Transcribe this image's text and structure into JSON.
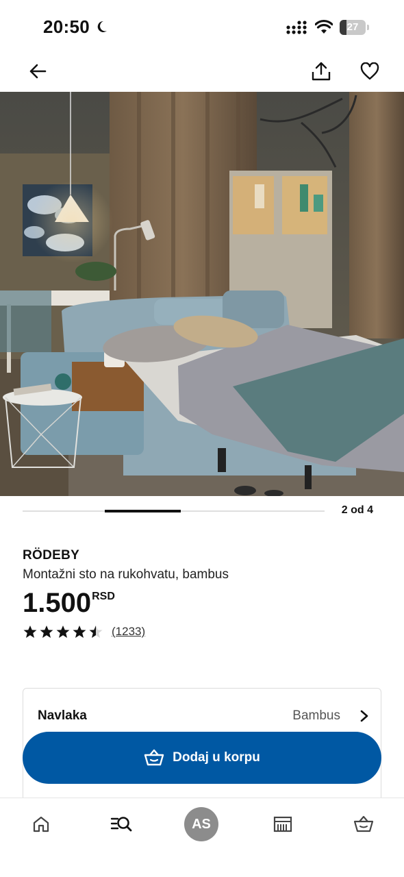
{
  "status_bar": {
    "time": "20:50",
    "battery_level": "27",
    "battery_fraction": 0.27
  },
  "nav": {
    "back_icon": "arrow-left-icon",
    "share_icon": "share-icon",
    "favorite_icon": "heart-icon"
  },
  "gallery": {
    "position_label": "2 od 4",
    "current_index": 2,
    "total": 4
  },
  "product": {
    "name": "RÖDEBY",
    "description": "Montažni sto na rukohvatu, bambus",
    "price": "1.500",
    "currency": "RSD",
    "rating_value": 4.5,
    "rating_max": 5,
    "review_count": "(1233)"
  },
  "option": {
    "label": "Navlaka",
    "value": "Bambus"
  },
  "cart_button": {
    "label": "Dodaj u korpu",
    "color": "#0058a3"
  },
  "tab_bar": {
    "account_initials": "AS",
    "tabs": [
      "home-icon",
      "search-icon",
      "account-avatar",
      "store-icon",
      "cart-icon"
    ]
  }
}
